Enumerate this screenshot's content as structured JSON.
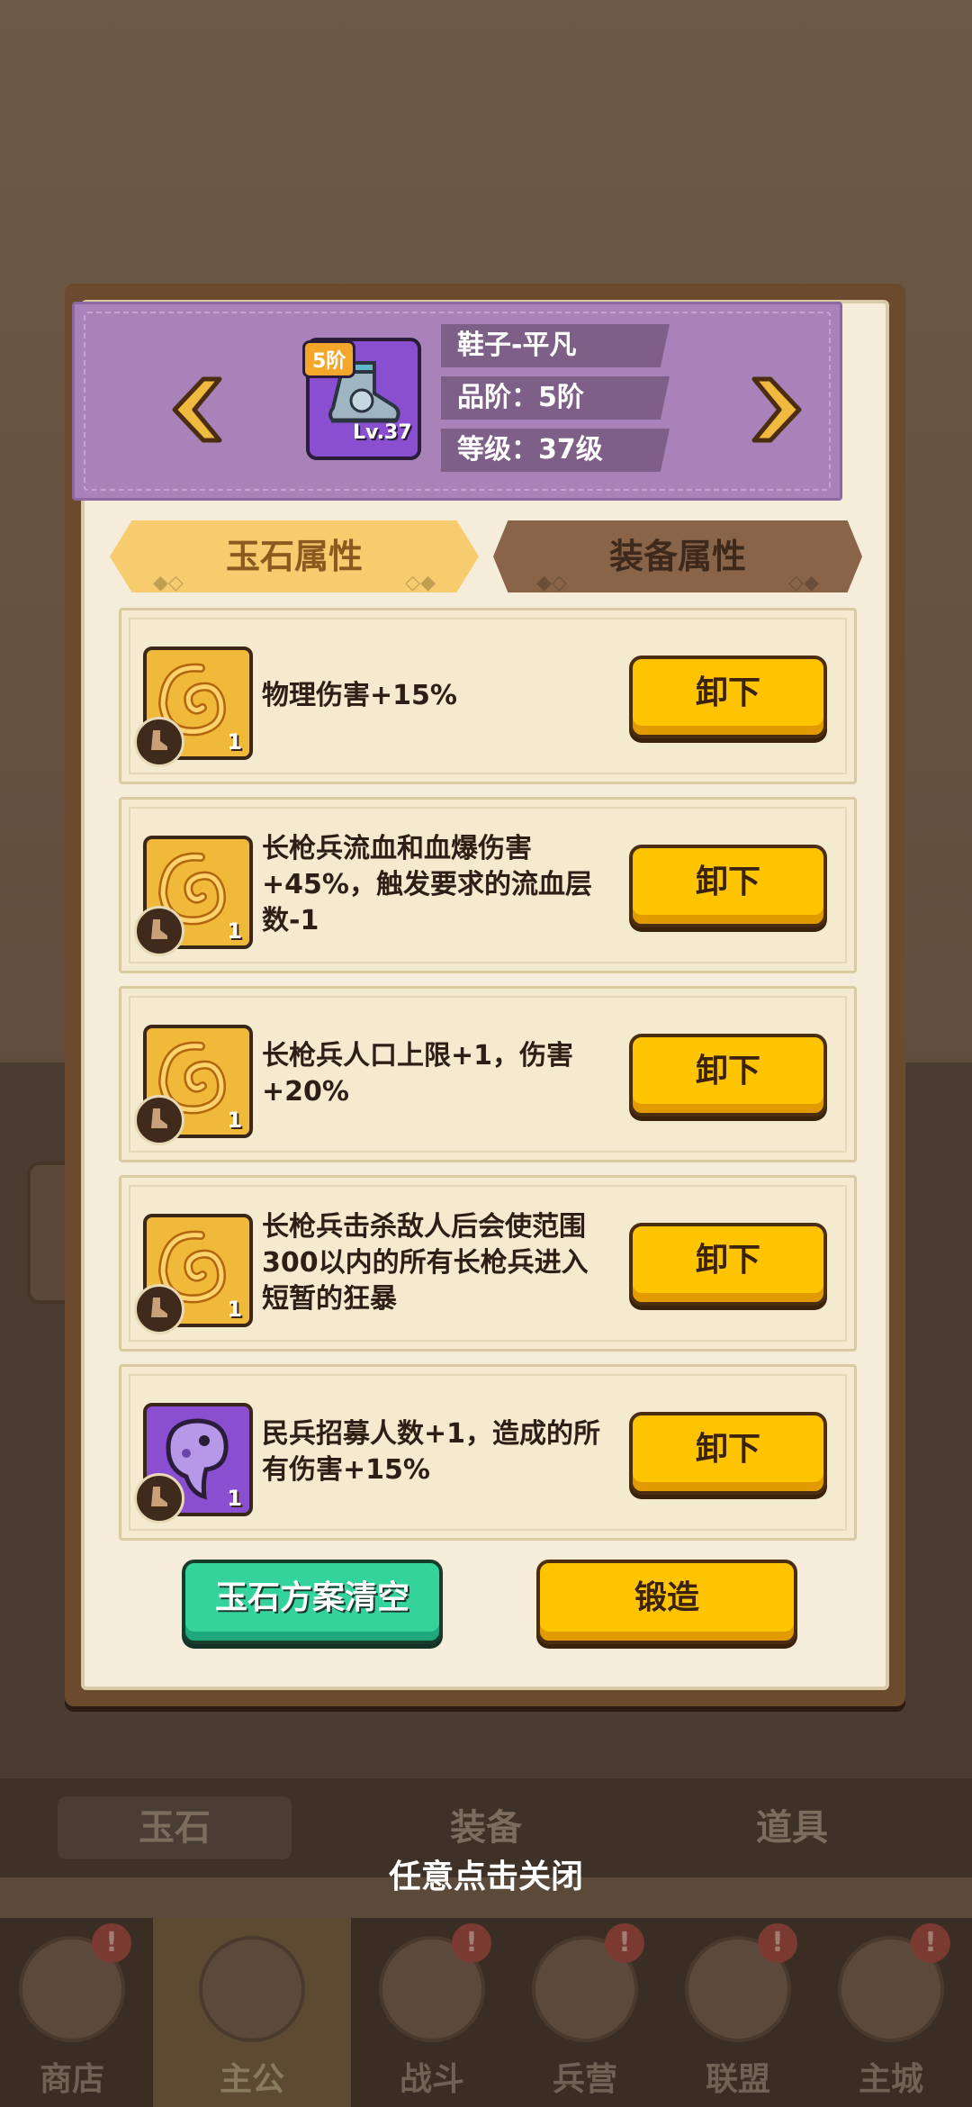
{
  "equipment": {
    "grade_badge": "5阶",
    "level_badge": "Lv.37",
    "name": "鞋子-平凡",
    "grade": "品阶：5阶",
    "level": "等级：37级"
  },
  "tabs": [
    {
      "label": "玉石属性",
      "active": true
    },
    {
      "label": "装备属性",
      "active": false
    }
  ],
  "gems": [
    {
      "color": "gold",
      "count": "1",
      "description": "物理伤害+15%",
      "action": "卸下"
    },
    {
      "color": "gold",
      "count": "1",
      "description": "长枪兵流血和血爆伤害+45%，触发要求的流血层数-1",
      "action": "卸下"
    },
    {
      "color": "gold",
      "count": "1",
      "description": "长枪兵人口上限+1，伤害+20%",
      "action": "卸下"
    },
    {
      "color": "gold",
      "count": "1",
      "description": "长枪兵击杀敌人后会使范围300以内的所有长枪兵进入短暂的狂暴",
      "action": "卸下"
    },
    {
      "color": "purple",
      "count": "1",
      "description": "民兵招募人数+1，造成的所有伤害+15%",
      "action": "卸下"
    }
  ],
  "buttons": {
    "clear": "玉石方案清空",
    "forge": "锻造"
  },
  "close_hint": "任意点击关闭",
  "background": {
    "category_tabs": [
      "玉石",
      "装备",
      "道具"
    ],
    "nav": [
      {
        "label": "商店",
        "badge": "!"
      },
      {
        "label": "主公",
        "badge": ""
      },
      {
        "label": "战斗",
        "badge": "!"
      },
      {
        "label": "兵营",
        "badge": "!"
      },
      {
        "label": "联盟",
        "badge": "!"
      },
      {
        "label": "主城",
        "badge": "!"
      }
    ]
  },
  "colors": {
    "primary_button": "#ffc400",
    "clear_button": "#33d39b",
    "header_purple": "#a882b8",
    "panel_bg": "#f5edd9"
  }
}
